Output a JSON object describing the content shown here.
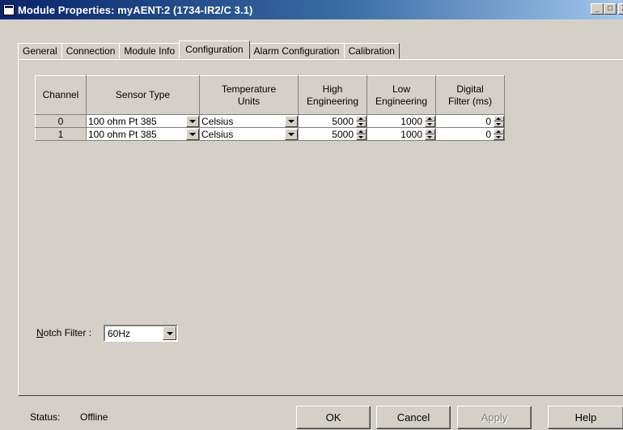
{
  "window": {
    "title": "Module Properties: myAENT:2 (1734-IR2/C 3.1)",
    "minimize": "_",
    "maximize": "□",
    "close": "X"
  },
  "tabs": [
    "General",
    "Connection",
    "Module Info",
    "Configuration",
    "Alarm Configuration",
    "Calibration"
  ],
  "active_tab": "Configuration",
  "grid": {
    "headers": {
      "channel": "Channel",
      "sensor_type": "Sensor Type",
      "temp_units_1": "Temperature",
      "temp_units_2": "Units",
      "high_eng_1": "High",
      "high_eng_2": "Engineering",
      "low_eng_1": "Low",
      "low_eng_2": "Engineering",
      "filter_1": "Digital",
      "filter_2": "Filter (ms)"
    },
    "rows": [
      {
        "channel": "0",
        "sensor_type": "100 ohm Pt 385",
        "units": "Celsius",
        "high": "5000",
        "low": "1000",
        "filter": "0"
      },
      {
        "channel": "1",
        "sensor_type": "100 ohm Pt 385",
        "units": "Celsius",
        "high": "5000",
        "low": "1000",
        "filter": "0"
      }
    ]
  },
  "notch_filter": {
    "label_mnemonic": "N",
    "label_rest": "otch Filter :",
    "value": "60Hz"
  },
  "status": {
    "label": "Status:",
    "value": "Offline"
  },
  "buttons": {
    "ok": "OK",
    "cancel": "Cancel",
    "apply": "Apply",
    "help": "Help"
  },
  "colors": {
    "face": "#d4d0c8",
    "title_start": "#0a246a",
    "title_end": "#a6caf0"
  }
}
